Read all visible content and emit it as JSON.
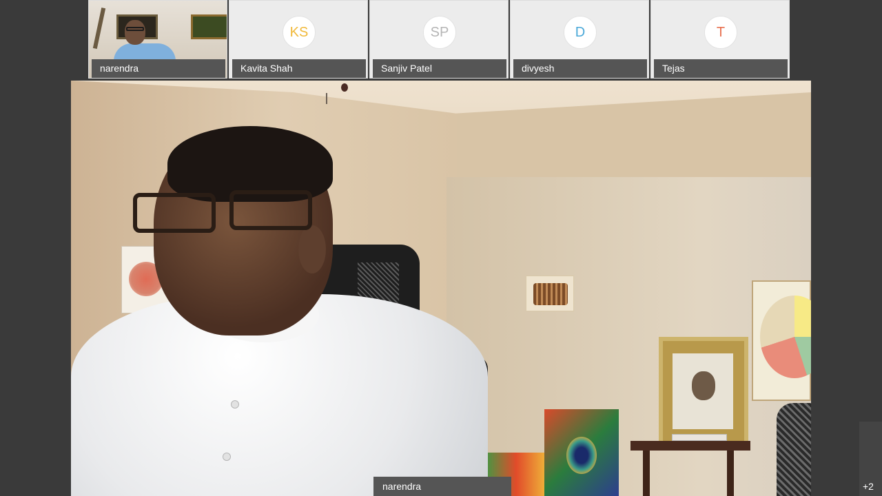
{
  "participants": [
    {
      "name": "narendra",
      "type": "video"
    },
    {
      "name": "Kavita Shah",
      "initials": "KS",
      "initials_color": "#f0b93a"
    },
    {
      "name": "Sanjiv Patel",
      "initials": "SP",
      "initials_color": "#b5b5b5"
    },
    {
      "name": "divyesh",
      "initials": "D",
      "initials_color": "#4aa8d8"
    },
    {
      "name": "Tejas",
      "initials": "T",
      "initials_color": "#e8704f"
    }
  ],
  "active_speaker": {
    "name": "narendra"
  },
  "overflow": {
    "count_label": "+2"
  },
  "colors": {
    "background": "#3a3a3a",
    "nameplate": "#555555",
    "tile": "#ececec"
  }
}
